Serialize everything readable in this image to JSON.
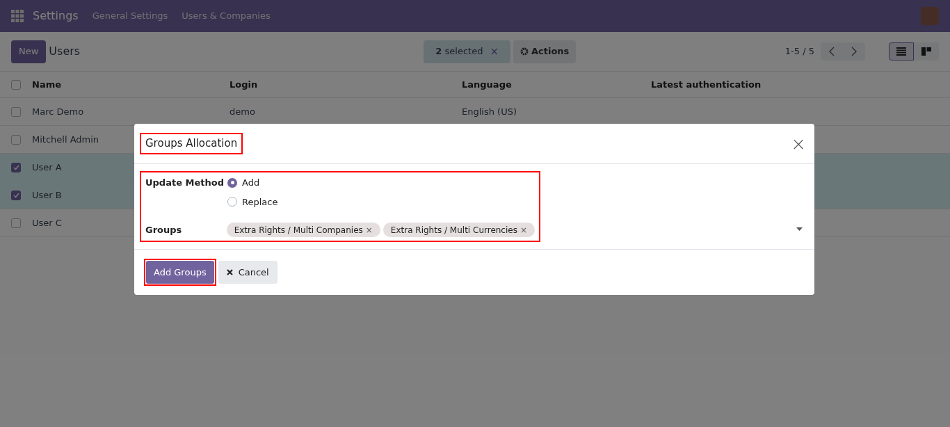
{
  "navbar": {
    "app": "Settings",
    "menus": [
      "General Settings",
      "Users & Companies"
    ]
  },
  "control_panel": {
    "new_button": "New",
    "title": "Users",
    "selection": {
      "count": "2",
      "label": "selected",
      "clear": "×"
    },
    "actions": "Actions",
    "pager": "1-5 / 5",
    "views": [
      {
        "kind": "list",
        "selected": true
      },
      {
        "kind": "kanban",
        "selected": false
      }
    ]
  },
  "table": {
    "columns": [
      "Name",
      "Login",
      "Language",
      "Latest authentication"
    ],
    "header_checked": false,
    "rows": [
      {
        "checked": false,
        "cells": [
          "Marc Demo",
          "demo",
          "English (US)",
          ""
        ]
      },
      {
        "checked": false,
        "cells": [
          "Mitchell Admin",
          "",
          "",
          ""
        ]
      },
      {
        "checked": true,
        "cells": [
          "User A",
          "",
          "",
          ""
        ]
      },
      {
        "checked": true,
        "cells": [
          "User B",
          "",
          "",
          ""
        ]
      },
      {
        "checked": false,
        "cells": [
          "User C",
          "",
          "",
          ""
        ]
      }
    ]
  },
  "dialog": {
    "title": "Groups Allocation",
    "close": "×",
    "method_label": "Update Method",
    "methods": [
      {
        "label": "Add",
        "selected": true
      },
      {
        "label": "Replace",
        "selected": false
      }
    ],
    "groups_label": "Groups",
    "groups": [
      {
        "label": "Extra Rights / Multi Companies",
        "remove": "×"
      },
      {
        "label": "Extra Rights / Multi Currencies",
        "remove": "×"
      }
    ],
    "primary_button": "Add Groups",
    "cancel_button": "Cancel"
  }
}
